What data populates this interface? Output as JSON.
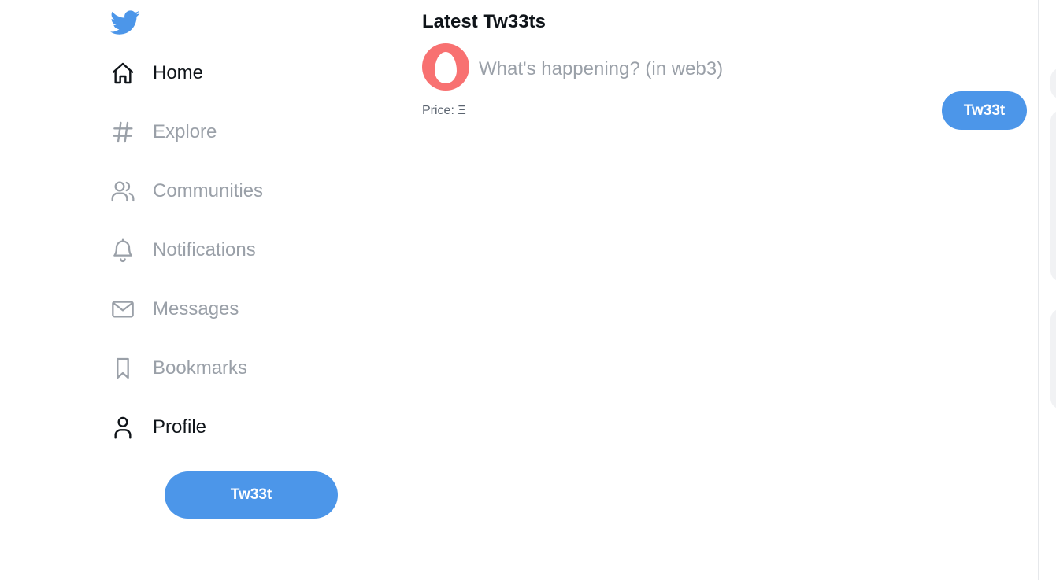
{
  "sidebar": {
    "logo": "twitter-bird-icon",
    "nav": [
      {
        "id": "home",
        "label": "Home",
        "icon": "home-icon",
        "active": true
      },
      {
        "id": "explore",
        "label": "Explore",
        "icon": "hashtag-icon",
        "active": false
      },
      {
        "id": "communities",
        "label": "Communities",
        "icon": "users-icon",
        "active": false
      },
      {
        "id": "notifications",
        "label": "Notifications",
        "icon": "bell-icon",
        "active": false
      },
      {
        "id": "messages",
        "label": "Messages",
        "icon": "mail-icon",
        "active": false
      },
      {
        "id": "bookmarks",
        "label": "Bookmarks",
        "icon": "bookmark-icon",
        "active": false
      },
      {
        "id": "profile",
        "label": "Profile",
        "icon": "user-icon",
        "active": true
      }
    ],
    "tweet_button": "Tw33t"
  },
  "feed": {
    "title": "Latest Tw33ts",
    "composer": {
      "placeholder": "What's happening? (in web3)",
      "value": "",
      "price_label": "Price: Ξ",
      "submit_label": "Tw33t"
    }
  },
  "colors": {
    "accent": "#4c96e9",
    "avatar": "#f87171",
    "muted_text": "#9aa0a8",
    "active_text": "#0f1419",
    "divider": "#e6e8eb"
  }
}
